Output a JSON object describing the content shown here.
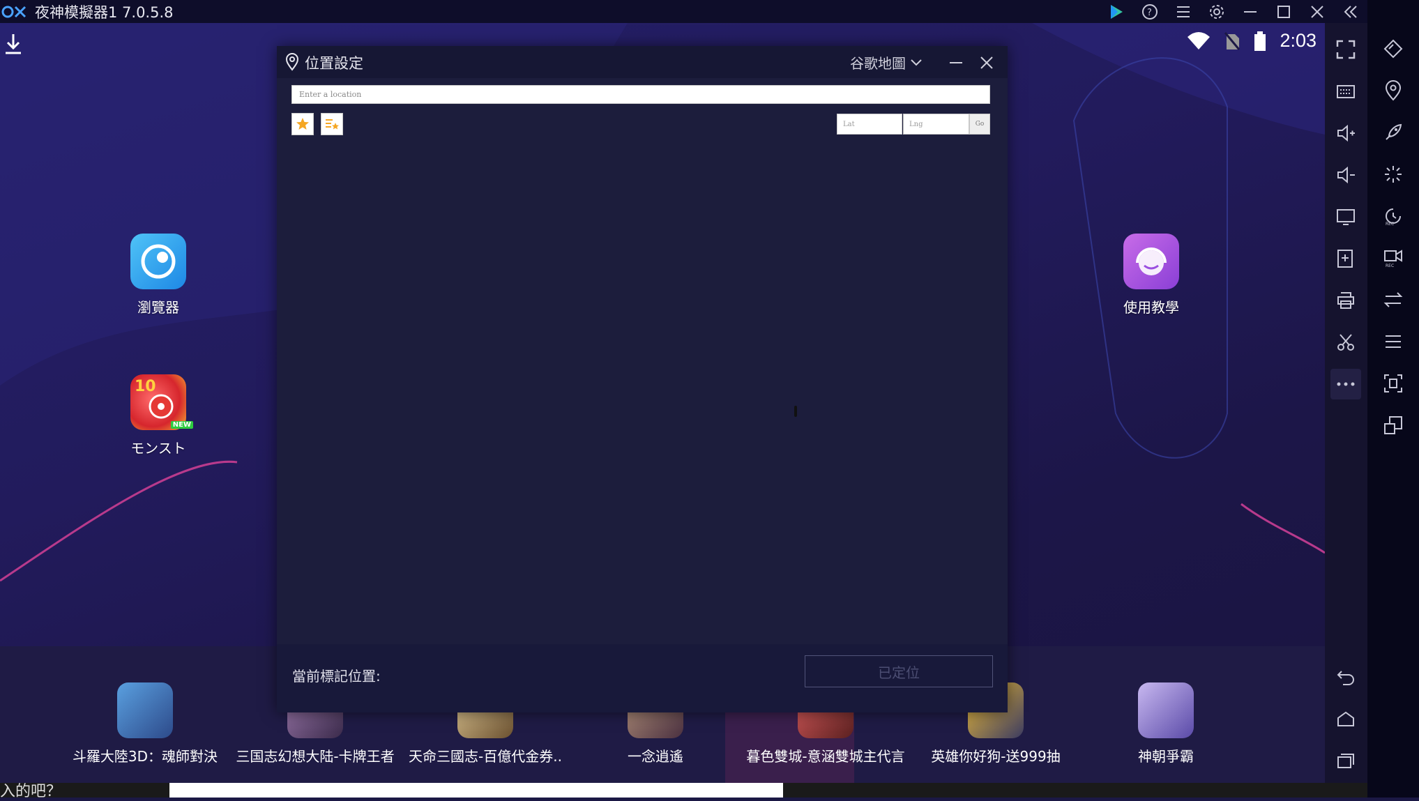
{
  "window": {
    "title": "夜神模擬器1 7.0.5.8",
    "logo": "nox-logo",
    "controls": [
      "play-store-icon",
      "help-icon",
      "menu-icon",
      "settings-icon",
      "minimize-icon",
      "maximize-icon",
      "close-icon",
      "collapse-icon"
    ]
  },
  "status_bar": {
    "time": "2:03",
    "icons": [
      "wifi-icon",
      "no-sim-icon",
      "battery-icon"
    ]
  },
  "desktop": {
    "apps": [
      {
        "label": "瀏覽器",
        "icon": "browser-icon"
      },
      {
        "label": "モンスト",
        "icon": "monst-icon",
        "badge": "NEW"
      },
      {
        "label": "使用教學",
        "icon": "tutorial-icon"
      }
    ],
    "dock": [
      {
        "label": "斗羅大陸3D：魂師對決"
      },
      {
        "label": "三国志幻想大陆-卡牌王者"
      },
      {
        "label": "天命三國志-百億代金券.."
      },
      {
        "label": "一念逍遙"
      },
      {
        "label": "暮色雙城-意涵雙城主代言"
      },
      {
        "label": "英雄你好狗-送999抽"
      },
      {
        "label": "神朝爭霸"
      }
    ],
    "bottom_text": "入的吧？"
  },
  "dialog": {
    "title": "位置設定",
    "map_type": "谷歌地圖",
    "search_placeholder": "Enter a location",
    "lat_placeholder": "Lat",
    "lng_placeholder": "Lng",
    "go_label": "Go",
    "current_label": "當前標記位置:",
    "located_label": "已定位"
  },
  "toolbar_mid": [
    "fullscreen-icon",
    "keyboard-icon",
    "volume-up-icon",
    "volume-down-icon",
    "screen-icon",
    "add-apk-icon",
    "print-icon",
    "scissors-icon",
    "more-icon",
    "back-icon",
    "home-icon",
    "recents-icon"
  ],
  "toolbar_right": [
    "diamond-icon",
    "location-icon",
    "rocket-icon",
    "shake-icon",
    "record-icon",
    "video-icon",
    "transfer-icon",
    "list-icon",
    "screenshot-icon",
    "multi-window-icon"
  ],
  "colors": {
    "accent_orange": "#f5a623",
    "dialog_bg": "#1c1d3c"
  }
}
